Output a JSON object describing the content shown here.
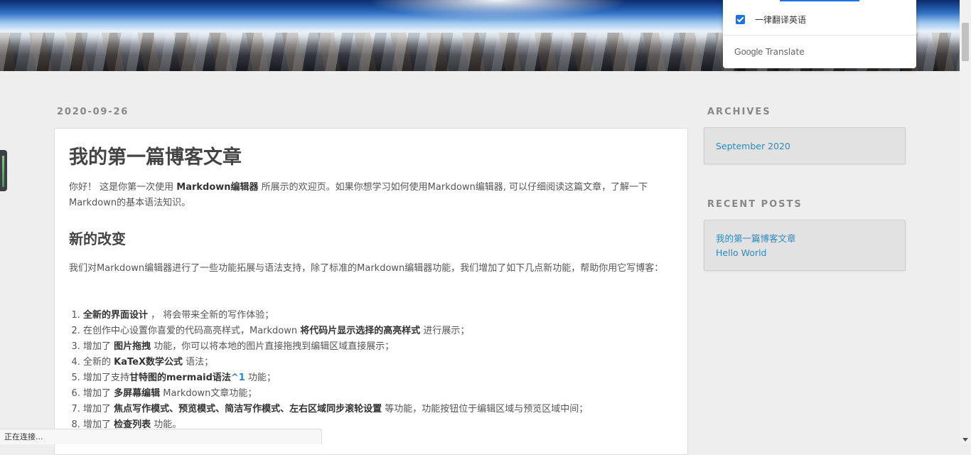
{
  "translate_popup": {
    "checkbox_label": "一律翻译英语",
    "brand_google": "Google",
    "brand_translate": "Translate"
  },
  "post": {
    "date": "2020-09-26",
    "title": "我的第一篇博客文章",
    "intro_a": "你好！ 这是你第一次使用 ",
    "intro_b": "Markdown编辑器",
    "intro_c": " 所展示的欢迎页。如果你想学习如何使用Markdown编辑器, 可以仔细阅读这篇文章，了解一下Markdown的基本语法知识。",
    "section_title": "新的改变",
    "section_body": "我们对Markdown编辑器进行了一些功能拓展与语法支持，除了标准的Markdown编辑器功能，我们增加了如下几点新功能，帮助你用它写博客：",
    "features": [
      {
        "pre": "",
        "bold": "全新的界面设计",
        "post": " ， 将会带来全新的写作体验；"
      },
      {
        "pre": "在创作中心设置你喜爱的代码高亮样式，Markdown ",
        "bold": "将代码片显示选择的高亮样式",
        "post": " 进行展示；"
      },
      {
        "pre": "增加了 ",
        "bold": "图片拖拽",
        "post": " 功能，你可以将本地的图片直接拖拽到编辑区域直接展示；"
      },
      {
        "pre": "全新的 ",
        "bold": "KaTeX数学公式",
        "post": " 语法；"
      },
      {
        "pre": "增加了支持",
        "bold": "甘特图的mermaid语法",
        "link": "^1",
        "post": " 功能；"
      },
      {
        "pre": "增加了 ",
        "bold": "多屏幕编辑",
        "post": " Markdown文章功能；"
      },
      {
        "pre": "增加了 ",
        "bold": "焦点写作模式、预览模式、简洁写作模式、左右区域同步滚轮设置",
        "post": " 等功能，功能按钮位于编辑区域与预览区域中间；"
      },
      {
        "pre": "增加了 ",
        "bold": "检查列表",
        "post": " 功能。"
      }
    ]
  },
  "sidebar": {
    "archives_title": "ARCHIVES",
    "archives": [
      "September 2020"
    ],
    "recent_title": "RECENT POSTS",
    "recent": [
      "我的第一篇博客文章",
      "Hello World"
    ]
  },
  "status": {
    "text": "正在连接..."
  },
  "colors": {
    "link": "#2a8ac4",
    "accent_blue": "#1a73e8"
  }
}
